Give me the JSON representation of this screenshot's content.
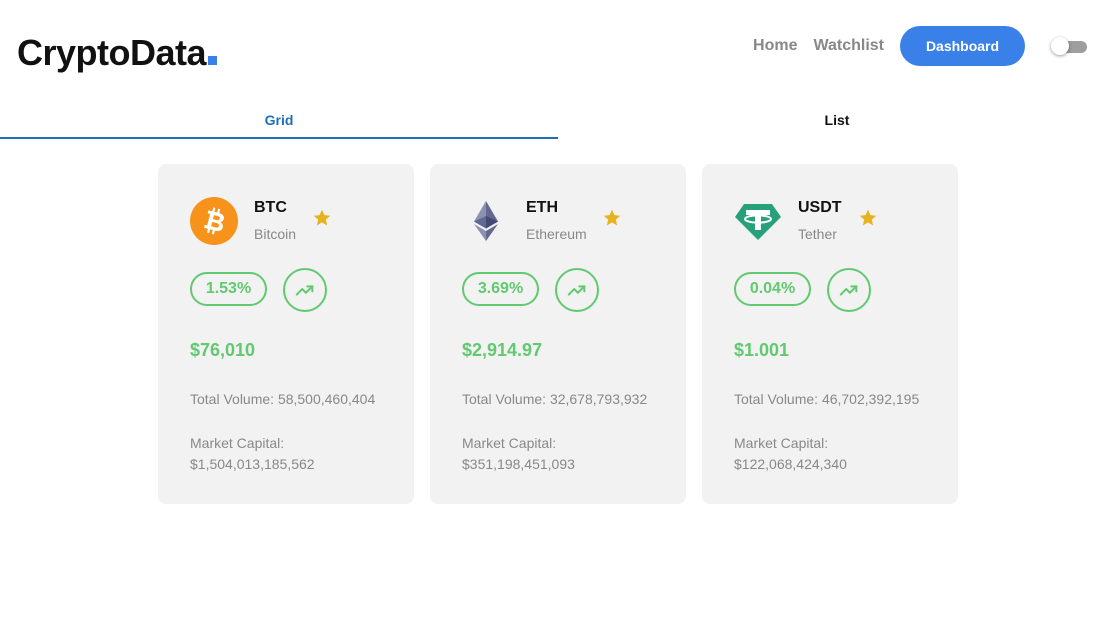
{
  "header": {
    "logo_text": "CryptoData",
    "nav": {
      "home": "Home",
      "watchlist": "Watchlist",
      "dashboard": "Dashboard"
    },
    "theme_toggle_on": false
  },
  "tabs": [
    {
      "label": "Grid",
      "active": true
    },
    {
      "label": "List",
      "active": false
    }
  ],
  "coins": [
    {
      "symbol": "BTC",
      "name": "Bitcoin",
      "icon": "bitcoin-icon",
      "change": "1.53%",
      "price": "$76,010",
      "total_volume": "Total Volume: 58,500,460,404",
      "market_cap_label": "Market Capital:",
      "market_cap": "$1,504,013,185,562"
    },
    {
      "symbol": "ETH",
      "name": "Ethereum",
      "icon": "ethereum-icon",
      "change": "3.69%",
      "price": "$2,914.97",
      "total_volume": "Total Volume: 32,678,793,932",
      "market_cap_label": "Market Capital:",
      "market_cap": "$351,198,451,093"
    },
    {
      "symbol": "USDT",
      "name": "Tether",
      "icon": "tether-icon",
      "change": "0.04%",
      "price": "$1.001",
      "total_volume": "Total Volume: 46,702,392,195",
      "market_cap_label": "Market Capital:",
      "market_cap": "$122,068,424,340"
    }
  ],
  "colors": {
    "accent": "#3a80e9",
    "positive": "#61c96f",
    "star": "#e8b21e",
    "card_bg": "#f2f2f2",
    "muted_text": "#888888",
    "tab_active": "#1f6fb8"
  }
}
